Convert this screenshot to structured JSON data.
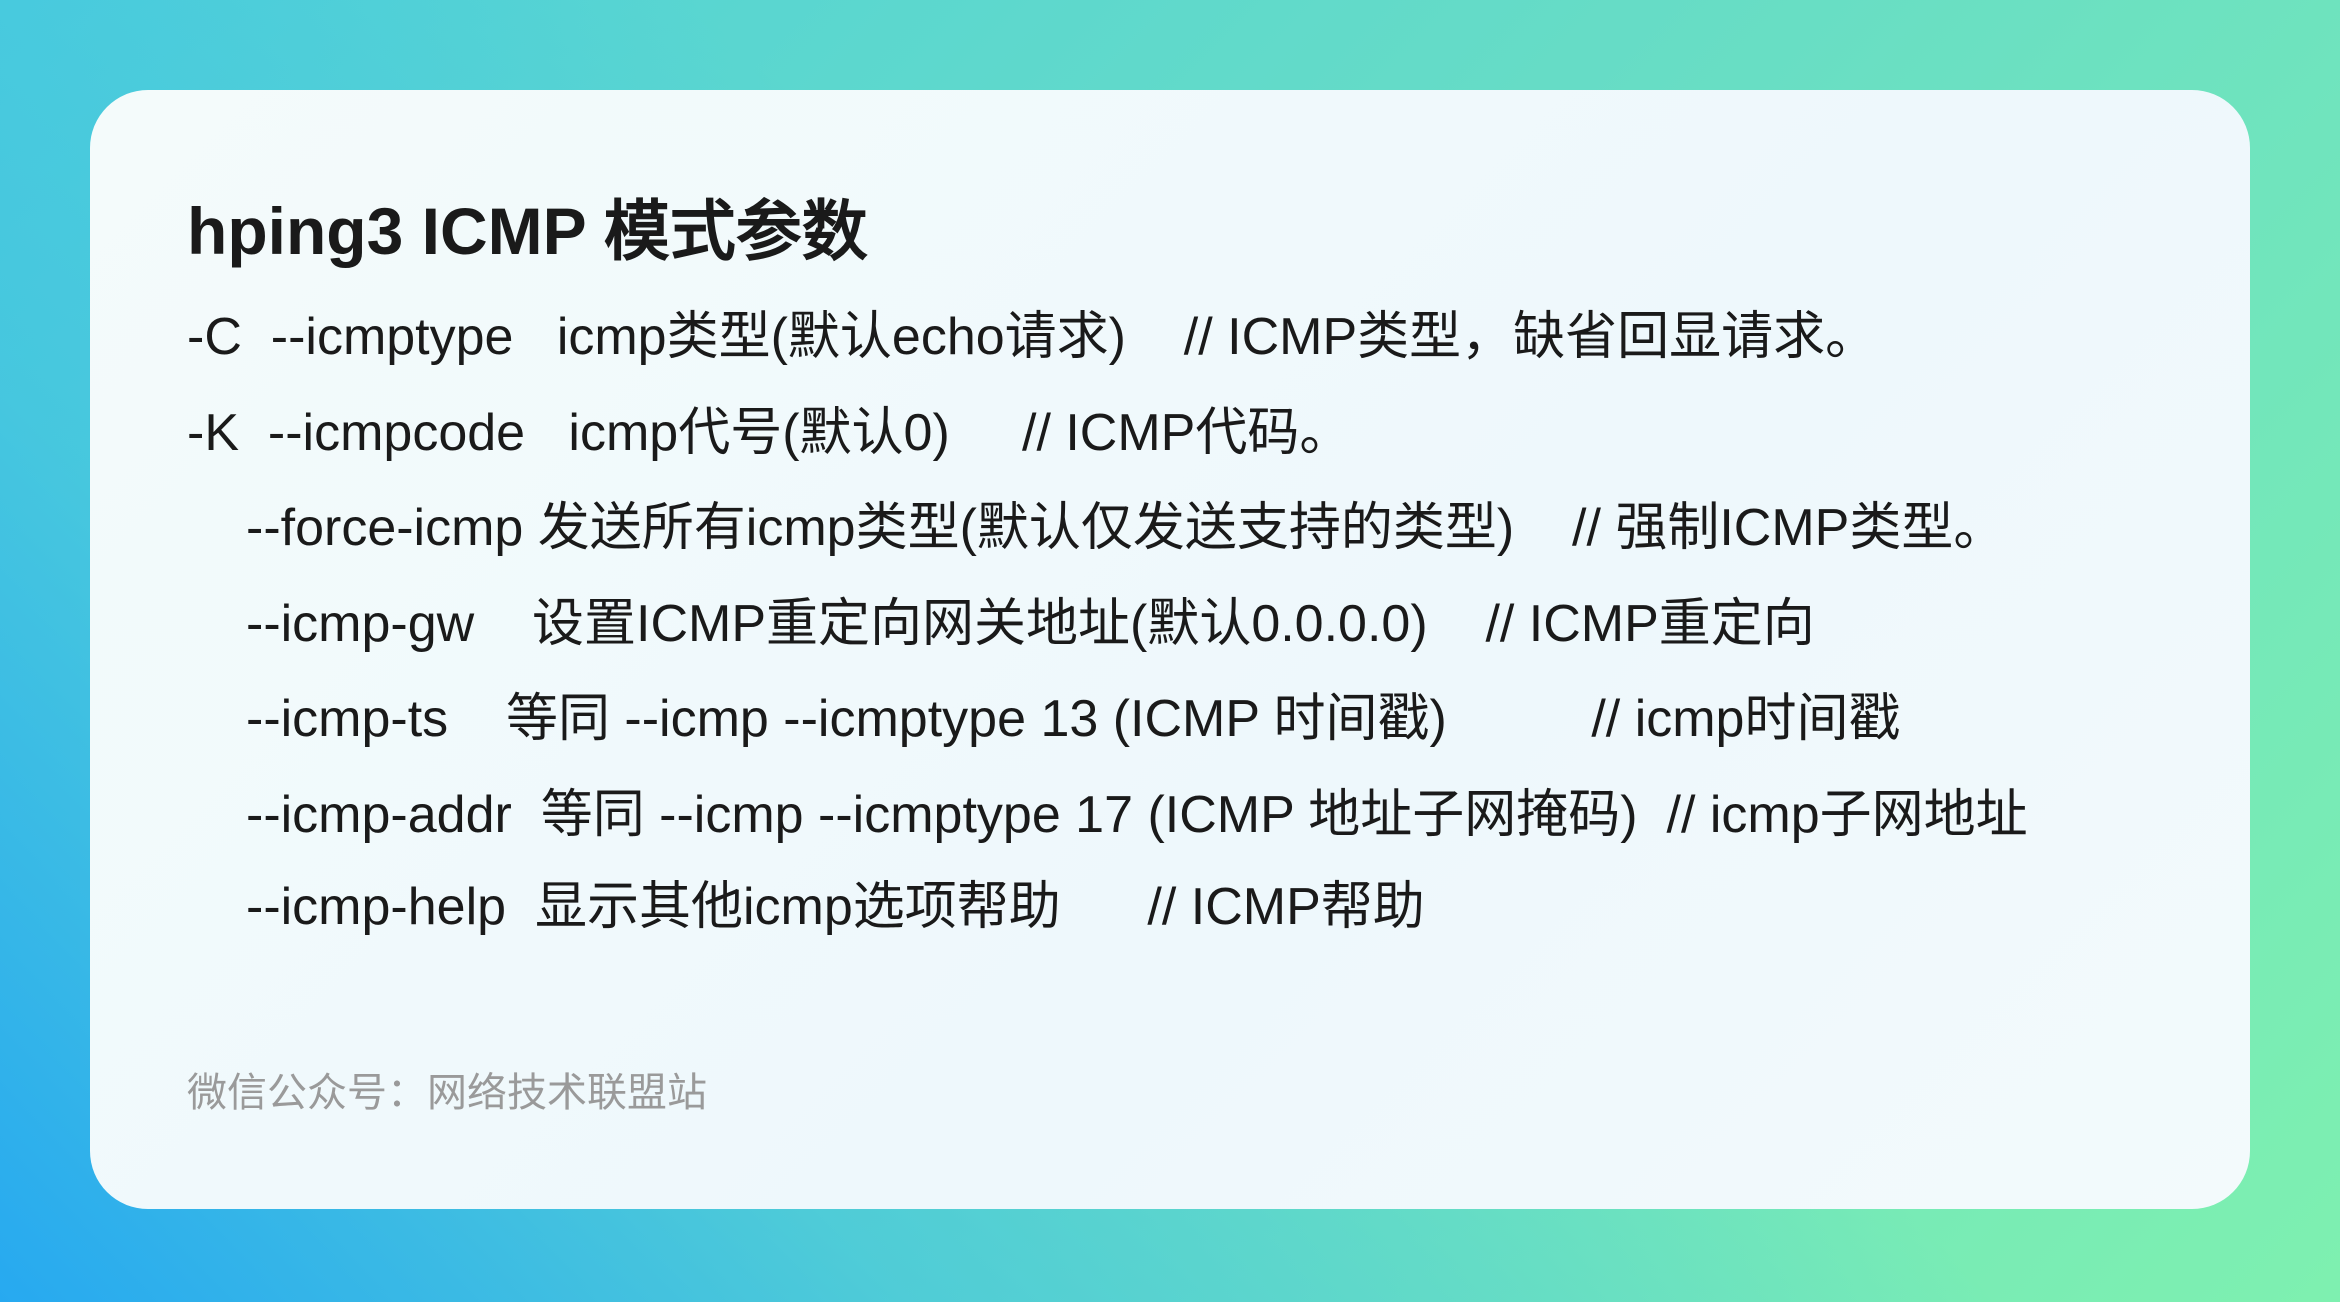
{
  "title": "hping3 ICMP 模式参数",
  "lines": [
    "-C  --icmptype   icmp类型(默认echo请求)    // ICMP类型，缺省回显请求。",
    "-K  --icmpcode   icmp代号(默认0)     // ICMP代码。",
    "--force-icmp 发送所有icmp类型(默认仅发送支持的类型)    // 强制ICMP类型。",
    "--icmp-gw    设置ICMP重定向网关地址(默认0.0.0.0)    // ICMP重定向",
    "--icmp-ts    等同 --icmp --icmptype 13 (ICMP 时间戳)          // icmp时间戳",
    "--icmp-addr  等同 --icmp --icmptype 17 (ICMP 地址子网掩码)  // icmp子网地址",
    "--icmp-help  显示其他icmp选项帮助      // ICMP帮助"
  ],
  "footer": "微信公众号：网络技术联盟站"
}
